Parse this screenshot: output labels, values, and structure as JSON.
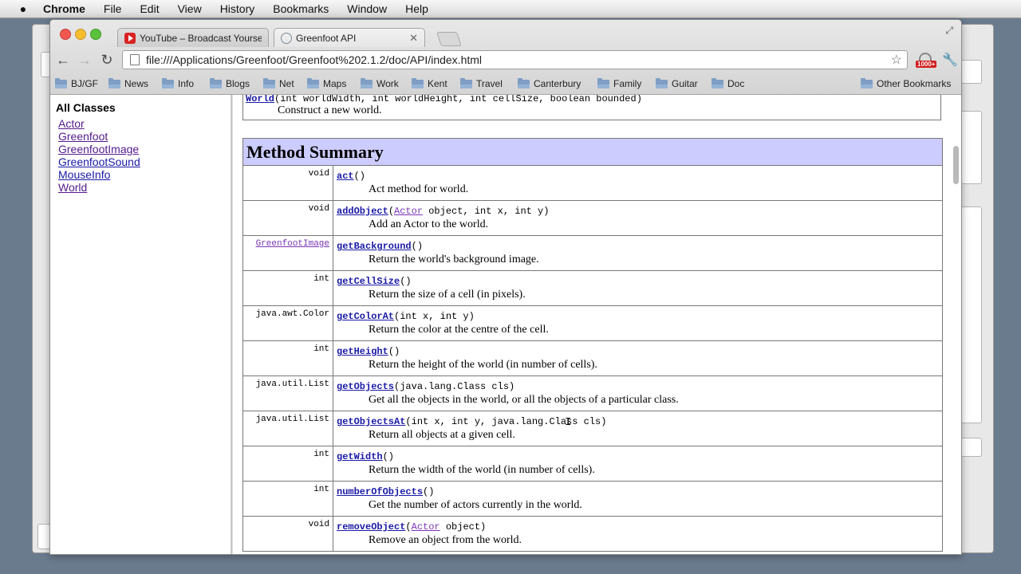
{
  "menubar": {
    "items": [
      "Chrome",
      "File",
      "Edit",
      "View",
      "History",
      "Bookmarks",
      "Window",
      "Help"
    ]
  },
  "tabs": [
    {
      "label": "YouTube – Broadcast Yourse",
      "icon": "youtube-favicon"
    },
    {
      "label": "Greenfoot API",
      "icon": "globe-favicon"
    }
  ],
  "omnibox": {
    "url": "file:///Applications/Greenfoot/Greenfoot%202.1.2/doc/API/index.html"
  },
  "extension": {
    "badge": "1000+"
  },
  "bookmarks": {
    "items": [
      "BJ/GF",
      "News",
      "Info",
      "Blogs",
      "Net",
      "Maps",
      "Work",
      "Kent",
      "Travel",
      "Canterbury",
      "Family",
      "Guitar",
      "Doc"
    ],
    "other": "Other Bookmarks"
  },
  "sidebar": {
    "title": "All Classes",
    "classes": [
      "Actor",
      "Greenfoot",
      "GreenfootImage",
      "GreenfootSound",
      "MouseInfo",
      "World"
    ]
  },
  "constructor": {
    "name": "World",
    "params": "(int worldWidth, int worldHeight, int cellSize, boolean bounded)",
    "desc": "Construct a new world."
  },
  "method_summary": {
    "title": "Method Summary",
    "rows": [
      {
        "type": "void",
        "name": "act",
        "pre": "",
        "ptype": "",
        "post": "()",
        "desc": "Act method for world."
      },
      {
        "type": "void",
        "name": "addObject",
        "pre": "(",
        "ptype": "Actor",
        "post": " object, int x, int y)",
        "desc": "Add an Actor to the world."
      },
      {
        "type": "GreenfootImage",
        "type_link": true,
        "name": "getBackground",
        "pre": "",
        "ptype": "",
        "post": "()",
        "desc": "Return the world's background image."
      },
      {
        "type": "int",
        "name": "getCellSize",
        "pre": "",
        "ptype": "",
        "post": "()",
        "desc": "Return the size of a cell (in pixels)."
      },
      {
        "type": "java.awt.Color",
        "name": "getColorAt",
        "pre": "",
        "ptype": "",
        "post": "(int x, int y)",
        "desc": "Return the color at the centre of the cell."
      },
      {
        "type": "int",
        "name": "getHeight",
        "pre": "",
        "ptype": "",
        "post": "()",
        "desc": "Return the height of the world (in number of cells)."
      },
      {
        "type": "java.util.List",
        "name": "getObjects",
        "pre": "",
        "ptype": "",
        "post": "(java.lang.Class cls)",
        "desc": "Get all the objects in the world, or all the objects of a particular class."
      },
      {
        "type": "java.util.List",
        "name": "getObjectsAt",
        "pre": "",
        "ptype": "",
        "post": "(int x, int y, java.lang.Class cls)",
        "desc": "Return all objects at a given cell."
      },
      {
        "type": "int",
        "name": "getWidth",
        "pre": "",
        "ptype": "",
        "post": "()",
        "desc": "Return the width of the world (in number of cells)."
      },
      {
        "type": "int",
        "name": "numberOfObjects",
        "pre": "",
        "ptype": "",
        "post": "()",
        "desc": "Get the number of actors currently in the world."
      },
      {
        "type": "void",
        "name": "removeObject",
        "pre": "(",
        "ptype": "Actor",
        "post": " object)",
        "desc": "Remove an object from the world."
      }
    ]
  }
}
